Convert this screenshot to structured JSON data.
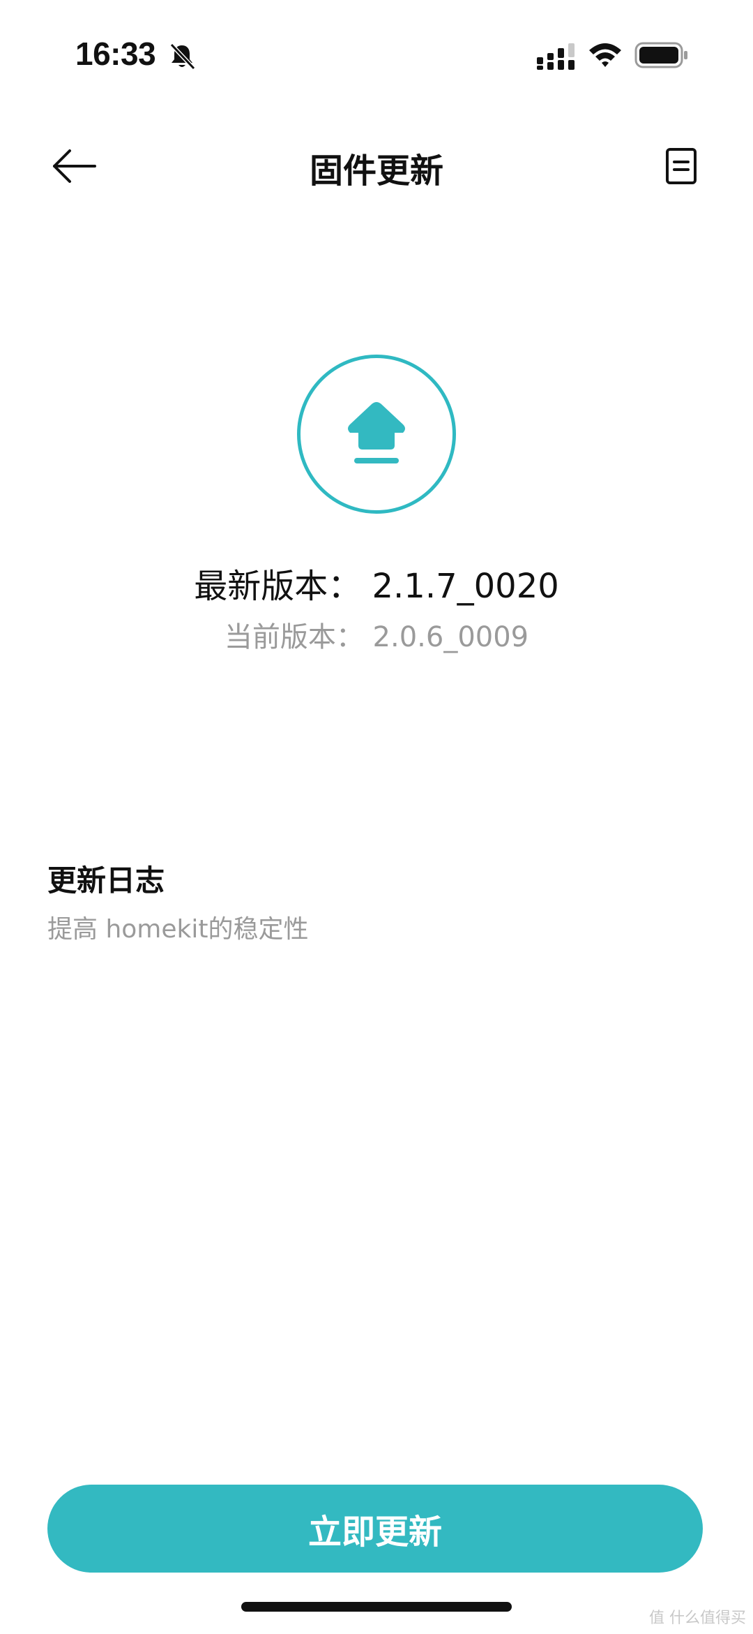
{
  "status_bar": {
    "time": "16:33",
    "icons": [
      "bell-slash-icon",
      "signal-icon",
      "wifi-icon",
      "battery-icon"
    ]
  },
  "nav": {
    "title": "固件更新",
    "back_icon": "arrow-left-icon",
    "right_icon": "document-icon"
  },
  "firmware": {
    "latest_version": "最新版本： 2.1.7_0020",
    "current_version": "当前版本： 2.0.6_0009"
  },
  "changelog": {
    "title": "更新日志",
    "text": "提高 homekit的稳定性"
  },
  "action": {
    "update_label": "立即更新"
  },
  "watermark": "值 什么值得买",
  "colors": {
    "accent": "#33b9c1",
    "text_primary": "#111111",
    "text_secondary": "#9a9a9a",
    "background": "#ffffff"
  }
}
